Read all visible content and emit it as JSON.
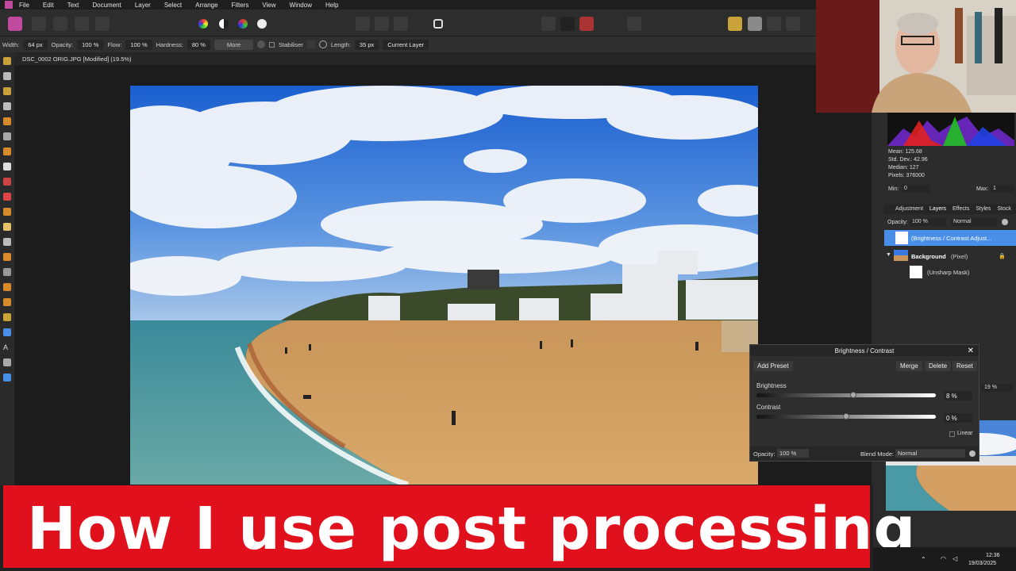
{
  "menubar": {
    "items": [
      "File",
      "Edit",
      "Text",
      "Document",
      "Layer",
      "Select",
      "Arrange",
      "Filters",
      "View",
      "Window",
      "Help"
    ]
  },
  "context": {
    "width_label": "Width:",
    "width_value": "64 px",
    "opacity_label": "Opacity:",
    "opacity_value": "100 %",
    "flow_label": "Flow:",
    "flow_value": "100 %",
    "hardness_label": "Hardness:",
    "hardness_value": "80 %",
    "more_label": "More",
    "stabiliser_label": "Stabiliser",
    "length_label": "Length:",
    "length_value": "35 px",
    "layer_mode": "Current Layer"
  },
  "document": {
    "tab_title": "DSC_0002 ORIG.JPG [Modified] (19.5%)"
  },
  "histogram": {
    "mean": "Mean: 125.68",
    "std": "Std. Dev.: 42.96",
    "median": "Median: 127",
    "pixels": "Pixels: 376000",
    "min_label": "Min:",
    "min_value": "0",
    "max_label": "Max:",
    "max_value": "1"
  },
  "panel_tabs": [
    "Adjustment",
    "Layers",
    "Effects",
    "Styles",
    "Stock"
  ],
  "layers_panel": {
    "opacity_label": "Opacity:",
    "opacity_value": "100 %",
    "blend": "Normal",
    "layers": [
      {
        "name": "(Brightness / Contrast Adjust..."
      },
      {
        "name": "Background",
        "suffix": "(Pixel)"
      },
      {
        "name": "(Unsharp Mask)"
      }
    ]
  },
  "navigator": {
    "zoom": "19 %"
  },
  "bc_dialog": {
    "title": "Brightness / Contrast",
    "add_preset": "Add Preset",
    "merge": "Merge",
    "delete": "Delete",
    "reset": "Reset",
    "brightness_label": "Brightness",
    "brightness_value": "8 %",
    "brightness_level": 0.54,
    "contrast_label": "Contrast",
    "contrast_value": "0 %",
    "contrast_level": 0.5,
    "linear_label": "Linear",
    "opacity_label": "Opacity:",
    "opacity_value": "100 %",
    "blend_label": "Blend Mode:",
    "blend_value": "Normal"
  },
  "banner": {
    "text": "How I use post processing"
  },
  "taskbar": {
    "time": "12:36",
    "date": "19/03/2025"
  },
  "colors": {
    "accent": "#4a8fe7",
    "banner": "#e0101d"
  }
}
